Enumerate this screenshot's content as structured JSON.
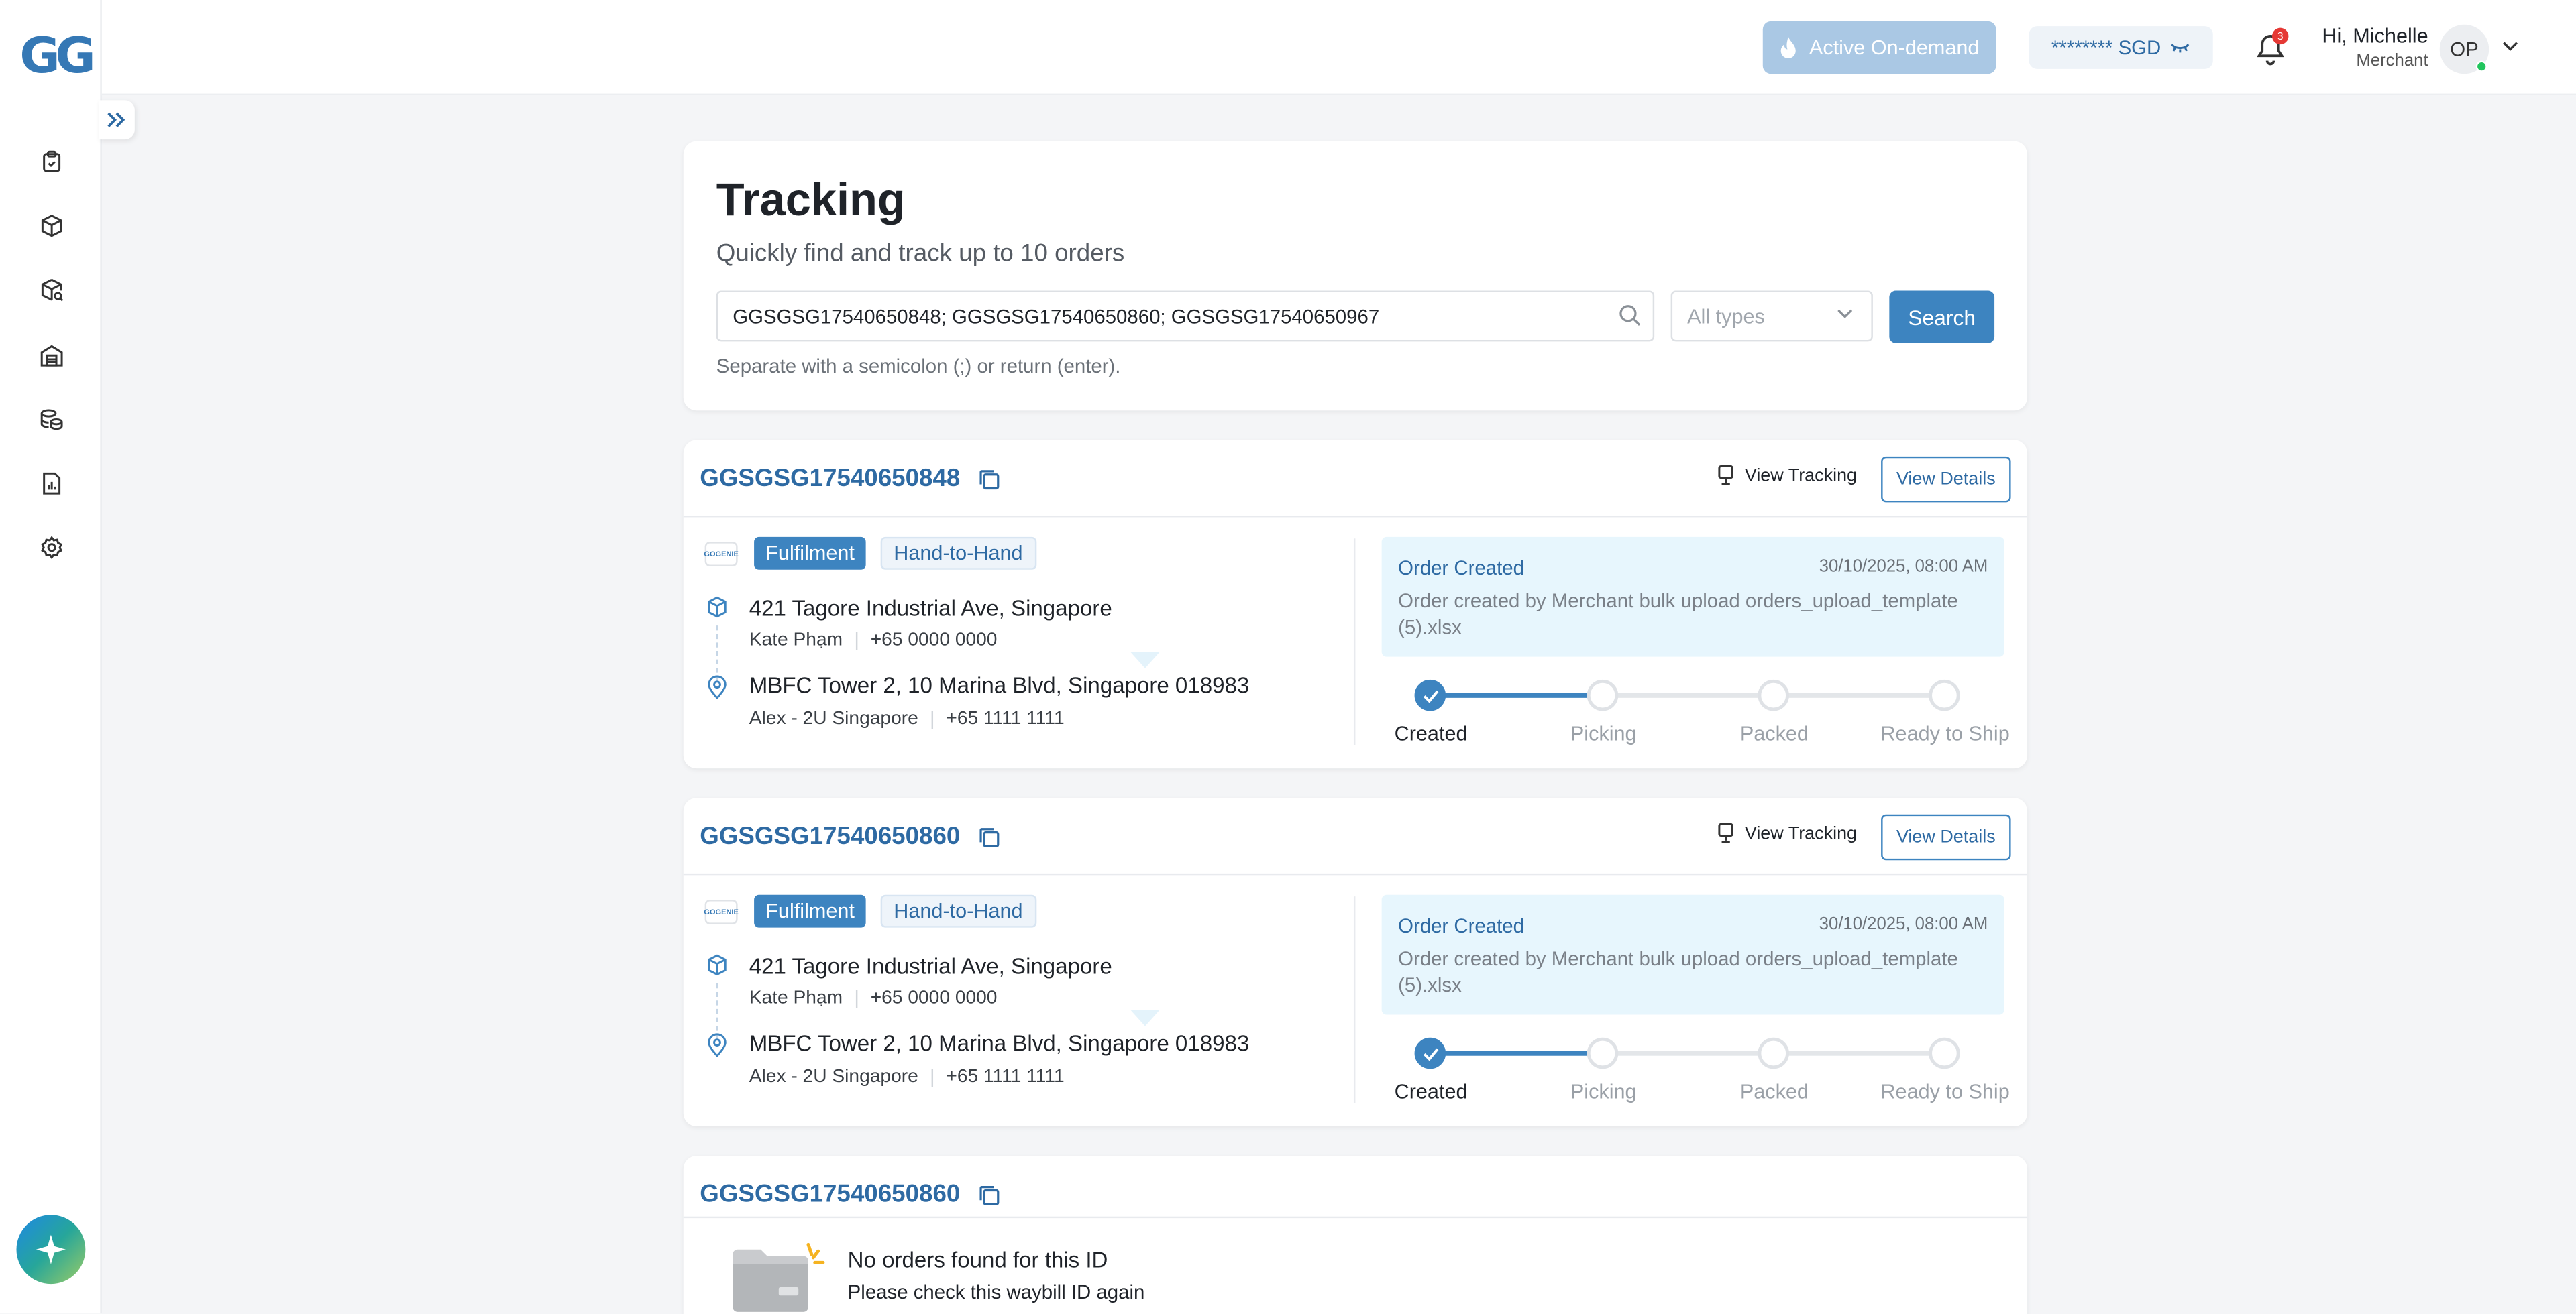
{
  "app": {
    "logo": "GG"
  },
  "header": {
    "on_demand_label": "Active On-demand",
    "balance": "******** SGD",
    "notification_count": "3",
    "greeting": "Hi, Michelle",
    "role": "Merchant",
    "avatar_initials": "OP"
  },
  "sidebar": {
    "items": [
      {
        "icon": "clipboard-icon"
      },
      {
        "icon": "box-icon"
      },
      {
        "icon": "box-search-icon"
      },
      {
        "icon": "warehouse-icon"
      },
      {
        "icon": "coins-icon"
      },
      {
        "icon": "report-icon"
      },
      {
        "icon": "settings-icon"
      }
    ]
  },
  "tracking": {
    "title": "Tracking",
    "subtitle": "Quickly find and track up to 10 orders",
    "search_value": "GGSGSG17540650848; GGSGSG17540650860; GGSGSG17540650967",
    "type_placeholder": "All types",
    "search_button": "Search",
    "hint": "Separate with a semicolon (;) or return (enter)."
  },
  "orders": [
    {
      "id": "GGSGSG17540650848",
      "view_tracking": "View Tracking",
      "view_details": "View Details",
      "brand_logo": "GOGENIE",
      "tags": [
        "Fulfilment",
        "Hand-to-Hand"
      ],
      "pickup": {
        "address": "421 Tagore Industrial Ave, Singapore",
        "name": "Kate Phạm",
        "phone": "+65 0000 0000"
      },
      "dropoff": {
        "address": "MBFC Tower 2, 10 Marina Blvd, Singapore 018983",
        "name": "Alex - 2U Singapore",
        "phone": "+65 1111 1111"
      },
      "event": {
        "title": "Order Created",
        "time": "30/10/2025, 08:00 AM",
        "desc": "Order created by Merchant bulk upload orders_upload_template (5).xlsx"
      },
      "steps": [
        "Created",
        "Picking",
        "Packed",
        "Ready to Ship"
      ],
      "completed_steps": 1
    },
    {
      "id": "GGSGSG17540650860",
      "view_tracking": "View Tracking",
      "view_details": "View Details",
      "brand_logo": "GOGENIE",
      "tags": [
        "Fulfilment",
        "Hand-to-Hand"
      ],
      "pickup": {
        "address": "421 Tagore Industrial Ave, Singapore",
        "name": "Kate Phạm",
        "phone": "+65 0000 0000"
      },
      "dropoff": {
        "address": "MBFC Tower 2, 10 Marina Blvd, Singapore 018983",
        "name": "Alex - 2U Singapore",
        "phone": "+65 1111 1111"
      },
      "event": {
        "title": "Order Created",
        "time": "30/10/2025, 08:00 AM",
        "desc": "Order created by Merchant bulk upload orders_upload_template (5).xlsx"
      },
      "steps": [
        "Created",
        "Picking",
        "Packed",
        "Ready to Ship"
      ],
      "completed_steps": 1
    }
  ],
  "not_found": {
    "id": "GGSGSG17540650860",
    "title": "No orders found for this ID",
    "subtitle": "Please check this waybill ID again"
  },
  "colors": {
    "primary": "#3d84c0",
    "link": "#2e6aa3",
    "event_bg": "#e7f6fd"
  }
}
